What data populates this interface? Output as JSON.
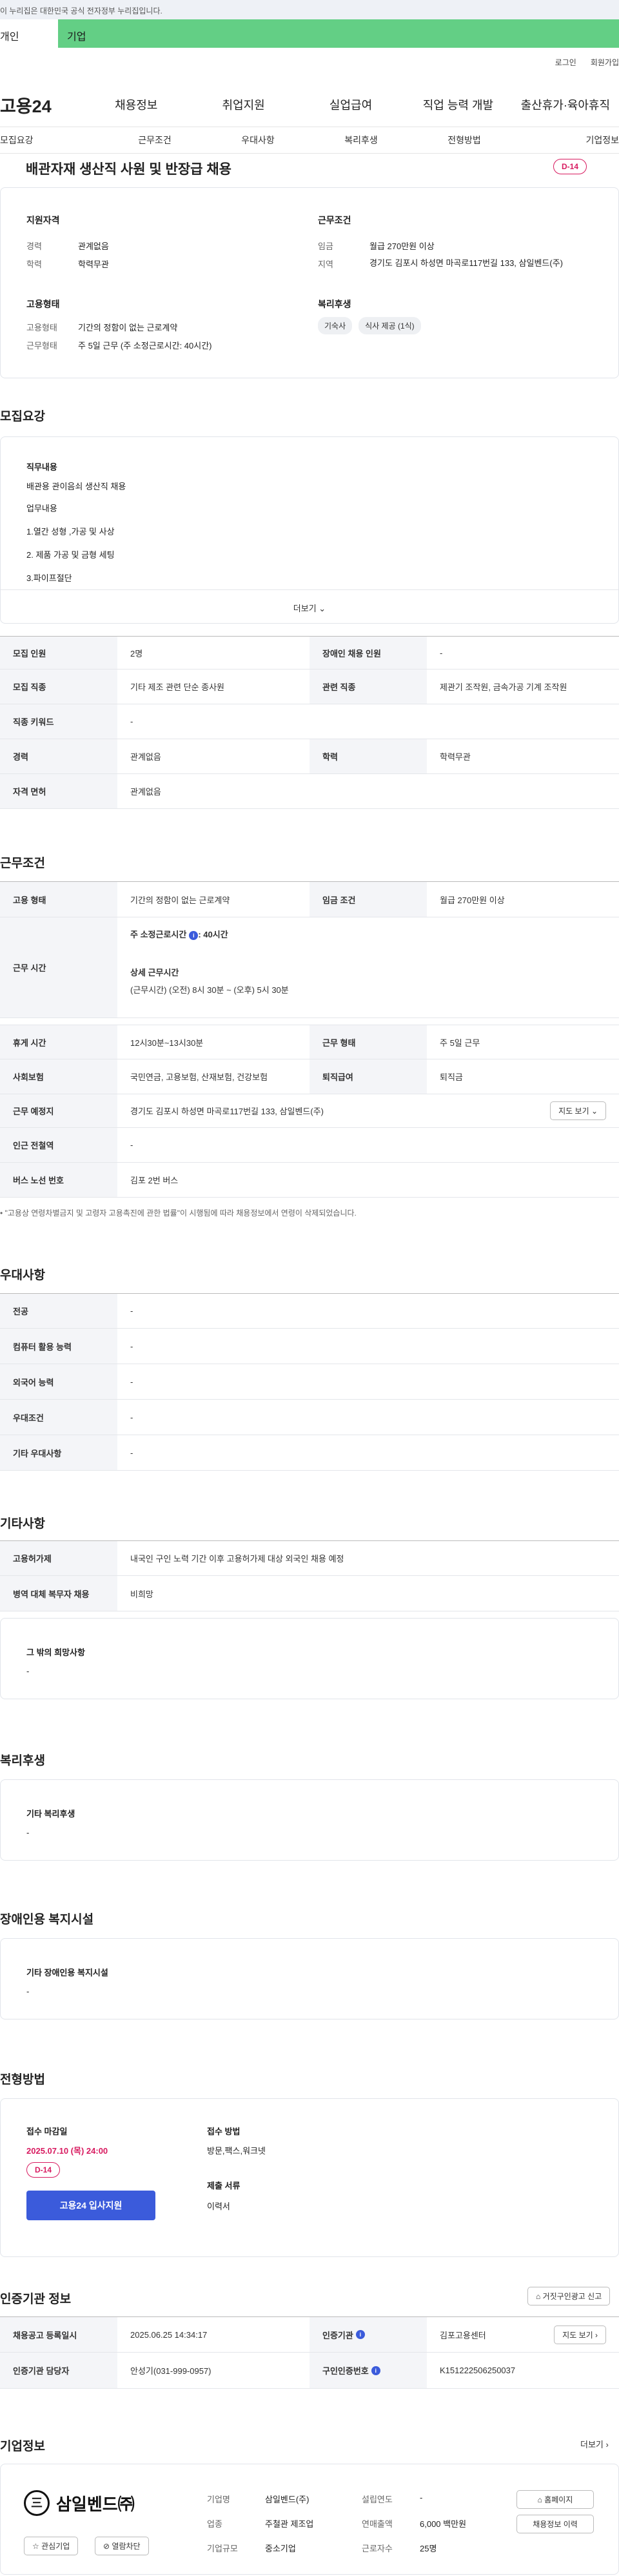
{
  "gov_banner": "이 누리집은 대한민국 공식 전자정부 누리집입니다.",
  "top_tabs": [
    "개인",
    "기업"
  ],
  "util": [
    "로그인",
    "회원가입"
  ],
  "logo": "고용24",
  "gnb": [
    "채용정보",
    "취업지원",
    "실업급여",
    "직업 능력 개발",
    "출산휴가·육아휴직"
  ],
  "subnav": [
    "모집요강",
    "근무조건",
    "우대사항",
    "복리후생",
    "전형방법",
    "기업정보"
  ],
  "job": {
    "title": "배관자재 생산직 사원 및 반장급 채용",
    "dday": "D-14"
  },
  "summary": {
    "qual_title": "지원자격",
    "career_k": "경력",
    "career_v": "관계없음",
    "edu_k": "학력",
    "edu_v": "학력무관",
    "cond_title": "근무조건",
    "wage_k": "임금",
    "wage_v": "월급 270만원 이상",
    "area_k": "지역",
    "area_v": "경기도 김포시 하성면 마곡로117번길 133, 삼일벤드(주)",
    "emp_title": "고용형태",
    "emp_k": "고용형태",
    "emp_v": "기간의 정함이 없는 근로계약",
    "wt_k": "근무형태",
    "wt_v": "주 5일 근무 (주 소정근로시간: 40시간)",
    "welfare_title": "복리후생",
    "chips": [
      "기숙사",
      "식사 제공 (1식)"
    ]
  },
  "recruit": {
    "sec": "모집요강",
    "duty_title": "직무내용",
    "duty_lines": [
      "배관용 관이음쇠 생산직 채용",
      "업무내용",
      "1.열간 성형 ,가공 및 사상",
      "2. 제품 가공 및 금형 세팅",
      "3.파이프절단"
    ],
    "more": "더보기",
    "r1": {
      "k1": "모집 인원",
      "v1": "2명",
      "k2": "장애인 채용 인원",
      "v2": "-"
    },
    "r2": {
      "k1": "모집 직종",
      "v1": "기타 제조 관련 단순 종사원",
      "k2": "관련 직종",
      "v2": "제관기 조작원, 금속가공 기계 조작원"
    },
    "r3": {
      "k1": "직종 키워드",
      "v1": "-"
    },
    "r4": {
      "k1": "경력",
      "v1": "관계없음",
      "k2": "학력",
      "v2": "학력무관"
    },
    "r5": {
      "k1": "자격 면허",
      "v1": "관계없음"
    }
  },
  "cond": {
    "sec": "근무조건",
    "r1": {
      "k1": "고용 형태",
      "v1": "기간의 정함이 없는 근로계약",
      "k2": "임금 조건",
      "v2": "월급 270만원 이상"
    },
    "r2": {
      "k1": "근무 시간",
      "week_label": "주 소정근로시간",
      "week_val": ": 40시간",
      "detail_label": "상세 근무시간",
      "detail_val": "(근무시간) (오전) 8시 30분 ~ (오후) 5시 30분"
    },
    "r3": {
      "k1": "휴게 시간",
      "v1": "12시30분~13시30분",
      "k2": "근무 형태",
      "v2": "주 5일 근무"
    },
    "r4": {
      "k1": "사회보험",
      "v1": "국민연금, 고용보험, 산재보험, 건강보험",
      "k2": "퇴직급여",
      "v2": "퇴직금"
    },
    "r5": {
      "k1": "근무 예정지",
      "v1": "경기도 김포시 하성면 마곡로117번길 133, 삼일벤드(주)",
      "btn": "지도 보기"
    },
    "r6": {
      "k1": "인근 전철역",
      "v1": "-"
    },
    "r7": {
      "k1": "버스 노선 번호",
      "v1": "김포 2번 버스"
    },
    "note": "\"고용상 연령차별금지 및 고령자 고용촉진에 관한 법률\"이 시행됨에 따라 채용정보에서 연령이 삭제되었습니다."
  },
  "pref": {
    "sec": "우대사항",
    "rows": [
      {
        "k": "전공",
        "v": "-"
      },
      {
        "k": "컴퓨터 활용 능력",
        "v": "-"
      },
      {
        "k": "외국어 능력",
        "v": "-"
      },
      {
        "k": "우대조건",
        "v": "-"
      },
      {
        "k": "기타 우대사항",
        "v": "-"
      }
    ]
  },
  "etc": {
    "sec": "기타사항",
    "r1": {
      "k": "고용허가제",
      "v": "내국인 구인 노력 기간 이후 고용허가제 대상 외국인 채용 예정"
    },
    "r2": {
      "k": "병역 대체 복무자 채용",
      "v": "비희망"
    },
    "other_title": "그 밖의 희망사항",
    "other_v": "-"
  },
  "welfare": {
    "sec": "복리후생",
    "title": "기타 복리후생",
    "v": "-"
  },
  "disab": {
    "sec": "장애인용 복지시설",
    "title": "기타 장애인용 복지시설",
    "v": "-"
  },
  "process": {
    "sec": "전형방법",
    "deadline_label": "접수 마감일",
    "deadline": "2025.07.10 (목) 24:00",
    "dday": "D-14",
    "apply_btn": "고용24 입사지원",
    "method_label": "접수 방법",
    "method_v": "방문,팩스,워크넷",
    "docs_label": "제출 서류",
    "docs_v": "이력서"
  },
  "agency": {
    "sec": "인증기관 정보",
    "report_btn": "거짓구인광고 신고",
    "r1": {
      "k1": "채용공고 등록일시",
      "v1": "2025.06.25 14:34:17",
      "k2": "인증기관",
      "v2": "김포고용센터",
      "btn": "지도 보기"
    },
    "r2": {
      "k1": "인증기관 담당자",
      "v1": "안성기(031-999-0957)",
      "k2": "구인인증번호",
      "v2": "K151222506250037"
    }
  },
  "company": {
    "sec": "기업정보",
    "more": "더보기",
    "logo_text": "삼일벤드㈜",
    "fav_btn": "관심기업",
    "block_btn": "열람차단",
    "k1": "기업명",
    "v1": "삼일벤드(주)",
    "k2": "설립연도",
    "v2": "-",
    "k3": "업종",
    "v3": "주철관 제조업",
    "k4": "연매출액",
    "v4": "6,000 백만원",
    "k5": "기업규모",
    "v5": "중소기업",
    "k6": "근로자수",
    "v6": "25명",
    "home_btn": "홈페이지",
    "history_btn": "채용정보 이력"
  },
  "colors": {
    "accent": "#63cf85",
    "dday": "#d81b60",
    "apply": "#3b5bdb"
  }
}
